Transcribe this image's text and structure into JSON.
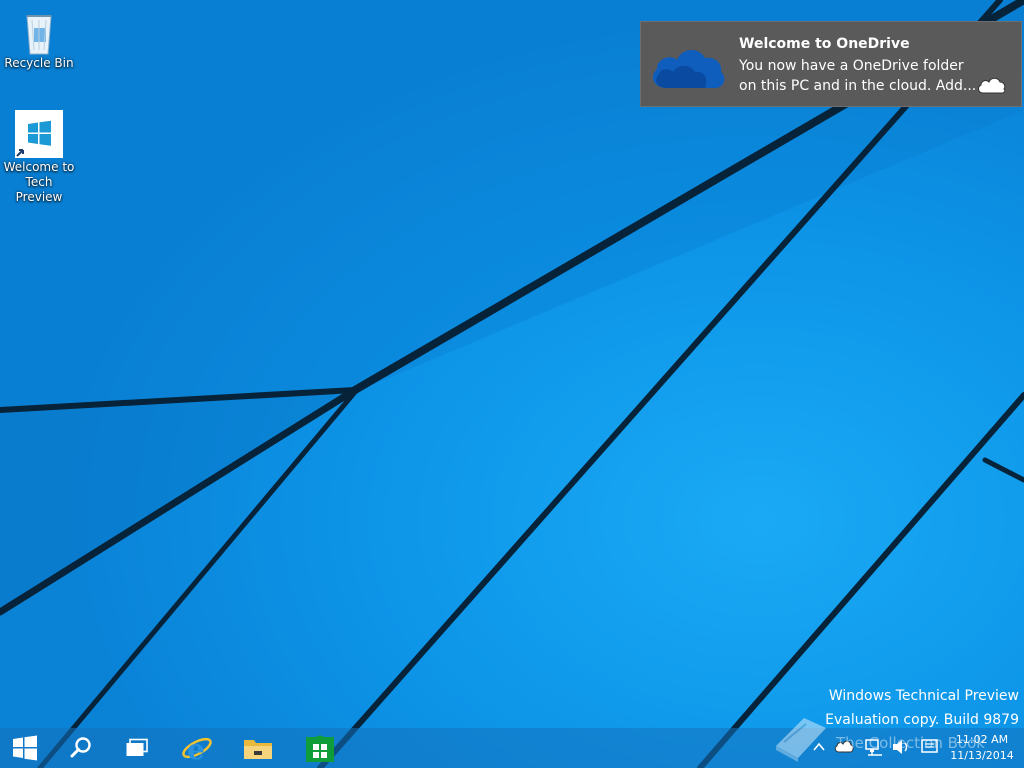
{
  "desktop": {
    "icons": [
      {
        "label": "Recycle Bin"
      },
      {
        "label": "Welcome to\nTech Preview"
      }
    ]
  },
  "toast": {
    "title": "Welcome to OneDrive",
    "body": "You now have a OneDrive folder\non this PC and in the cloud. Add..."
  },
  "watermark": {
    "line1": "Windows Technical Preview",
    "line2": "Evaluation copy. Build 9879"
  },
  "overlay_watermark": "The Collection Book",
  "taskbar": {
    "pinned": [
      "start-icon",
      "search-icon",
      "task-view-icon",
      "internet-explorer-icon",
      "file-explorer-icon",
      "store-icon"
    ],
    "tray": [
      "up-arrow-icon",
      "onedrive-icon",
      "network-icon",
      "volume-icon",
      "action-center-icon"
    ],
    "clock_time": "11:02 AM",
    "clock_date": "11/13/2014"
  },
  "colors": {
    "accent": "#0d95e8",
    "taskbar": "#1473be",
    "toast_bg": "#5a5a5a",
    "onedrive_blue": "#0f5dbd",
    "store_green": "#0f9d3a"
  }
}
